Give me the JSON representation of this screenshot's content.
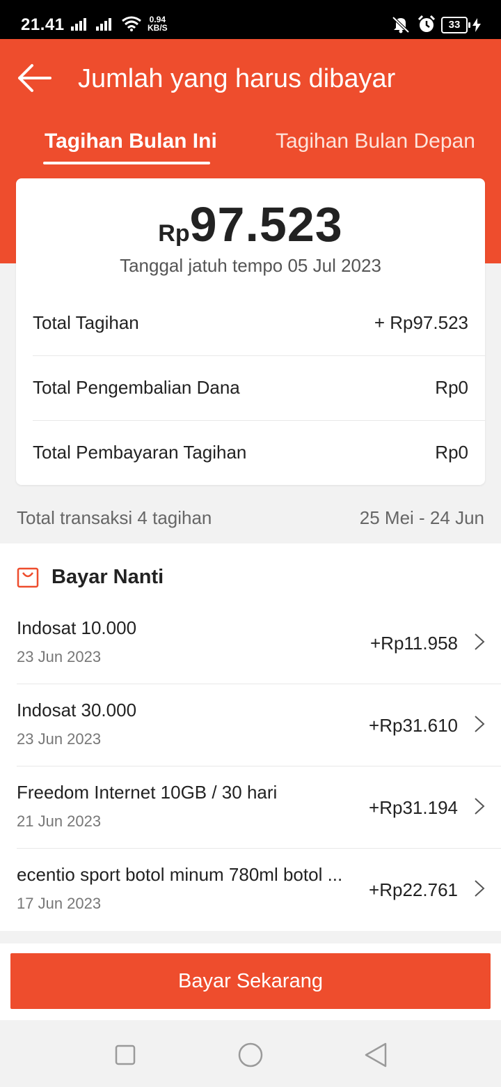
{
  "status_bar": {
    "time": "21.41",
    "net_speed_value": "0.94",
    "net_speed_unit": "KB/S",
    "battery": "33"
  },
  "header": {
    "title": "Jumlah yang harus dibayar",
    "tabs": [
      {
        "label": "Tagihan Bulan Ini",
        "active": true
      },
      {
        "label": "Tagihan Bulan Depan",
        "active": false
      }
    ]
  },
  "summary": {
    "currency": "Rp",
    "amount": "97.523",
    "due_date": "Tanggal jatuh tempo 05 Jul 2023",
    "rows": [
      {
        "label": "Total Tagihan",
        "value": "+ Rp97.523"
      },
      {
        "label": "Total Pengembalian Dana",
        "value": "Rp0"
      },
      {
        "label": "Total Pembayaran Tagihan",
        "value": "Rp0"
      }
    ]
  },
  "range": {
    "left": "Total transaksi 4 tagihan",
    "right": "25 Mei - 24 Jun"
  },
  "section": {
    "title": "Bayar Nanti",
    "icon": "shopping-bag-icon"
  },
  "transactions": [
    {
      "name": "Indosat 10.000",
      "date": "23 Jun 2023",
      "amount": "+Rp11.958"
    },
    {
      "name": "Indosat 30.000",
      "date": "23 Jun 2023",
      "amount": "+Rp31.610"
    },
    {
      "name": "Freedom Internet 10GB / 30 hari",
      "date": "21 Jun 2023",
      "amount": "+Rp31.194"
    },
    {
      "name": "ecentio sport botol minum 780ml botol ...",
      "date": "17 Jun 2023",
      "amount": "+Rp22.761"
    }
  ],
  "pay_button": {
    "label": "Bayar Sekarang"
  },
  "colors": {
    "accent": "#ee4d2d",
    "background": "#f2f2f2"
  }
}
